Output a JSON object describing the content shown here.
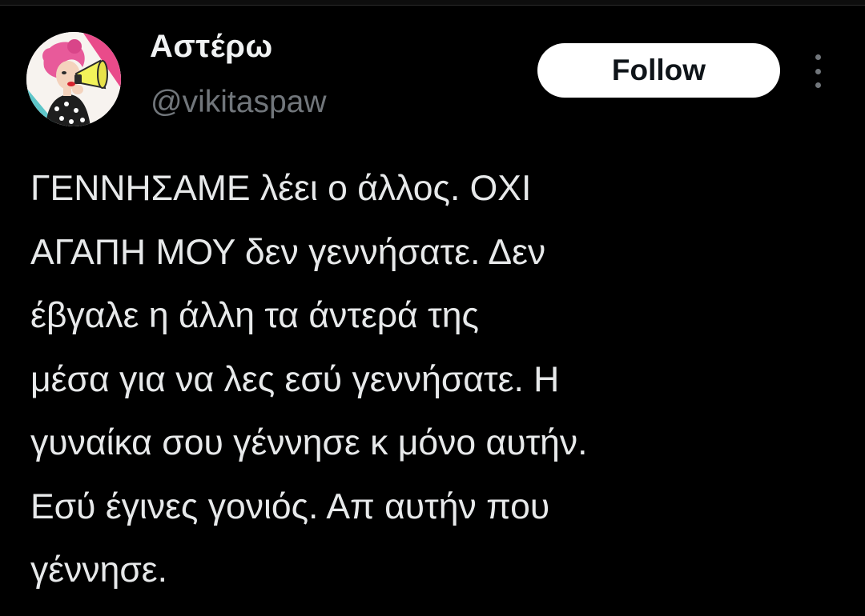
{
  "tweet": {
    "author": {
      "display_name": "Αστέρω",
      "handle": "@vikitaspaw",
      "avatar_icon": "pinup-woman-megaphone-avatar"
    },
    "follow_label": "Follow",
    "more_icon": "more-vertical-icon",
    "text_lines": [
      "ΓΕΝΝΗΣΑΜΕ λέει ο άλλος. ΟΧΙ",
      "ΑΓΑΠΗ ΜΟΥ δεν γεννήσατε. Δεν",
      "έβγαλε η άλλη τα άντερά της",
      "μέσα για να λες εσύ γεννήσατε. Η",
      "γυναίκα σου γέννησε κ μόνο αυτήν.",
      "Εσύ έγινες γονιός. Απ αυτήν που",
      "γέννησε."
    ]
  },
  "colors": {
    "background": "#000000",
    "text_primary": "#e7e9ea",
    "text_secondary": "#71767b",
    "button_bg": "#ffffff",
    "button_text": "#0f1419"
  }
}
